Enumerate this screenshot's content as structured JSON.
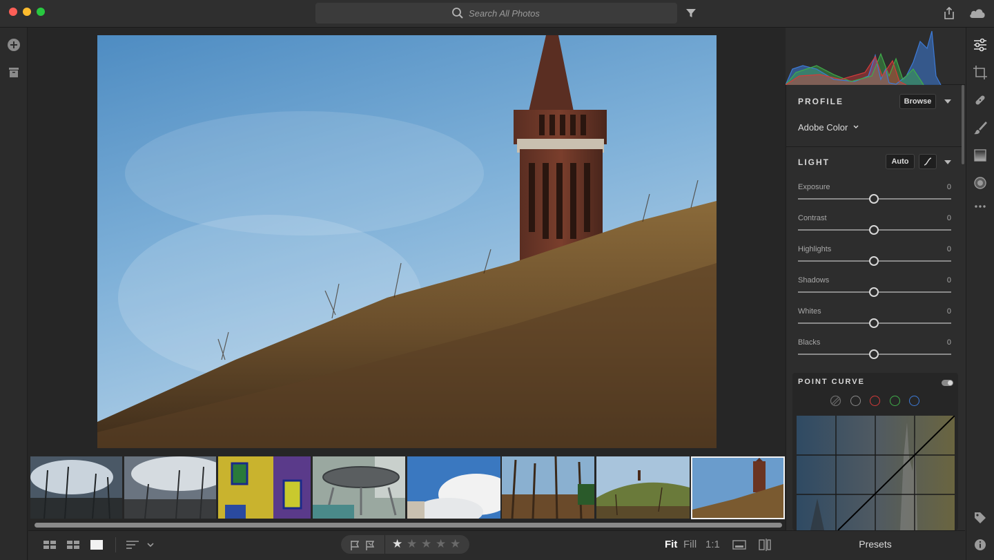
{
  "window": {
    "title": ""
  },
  "search": {
    "placeholder": "Search All Photos"
  },
  "filmstrip": {
    "thumbnails": [
      {
        "name": "thumb-1"
      },
      {
        "name": "thumb-2"
      },
      {
        "name": "thumb-3"
      },
      {
        "name": "thumb-4"
      },
      {
        "name": "thumb-5"
      },
      {
        "name": "thumb-6"
      },
      {
        "name": "thumb-7"
      },
      {
        "name": "thumb-8",
        "selected": true
      }
    ]
  },
  "toolbar": {
    "zoom_fit": "Fit",
    "zoom_fill": "Fill",
    "zoom_1to1": "1:1",
    "rating_stars": 1,
    "rating_max": 5
  },
  "profile": {
    "title": "PROFILE",
    "browse_label": "Browse",
    "value": "Adobe Color"
  },
  "light": {
    "title": "LIGHT",
    "auto_label": "Auto",
    "sliders": [
      {
        "label": "Exposure",
        "value": "0"
      },
      {
        "label": "Contrast",
        "value": "0"
      },
      {
        "label": "Highlights",
        "value": "0"
      },
      {
        "label": "Shadows",
        "value": "0"
      },
      {
        "label": "Whites",
        "value": "0"
      },
      {
        "label": "Blacks",
        "value": "0"
      }
    ]
  },
  "point_curve": {
    "title": "POINT CURVE",
    "channels": [
      "parametric",
      "rgb",
      "red",
      "green",
      "blue"
    ]
  },
  "presets": {
    "label": "Presets"
  },
  "colors": {
    "accent": "#ffffff",
    "panel_bg": "#2d2d2d",
    "red_channel": "#d43a3a",
    "green_channel": "#3fae4a",
    "blue_channel": "#3d7bd8"
  },
  "icons": {
    "left_rail": [
      "add-photos-icon",
      "archive-icon"
    ],
    "tool_rail": [
      "edit-sliders-icon",
      "crop-icon",
      "healing-icon",
      "brush-icon",
      "linear-gradient-icon",
      "radial-gradient-icon",
      "more-icon",
      "tag-icon",
      "info-icon"
    ]
  }
}
